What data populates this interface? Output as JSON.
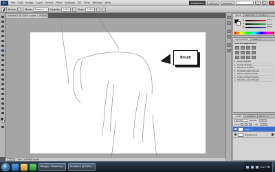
{
  "app": {
    "logo": "Ps"
  },
  "menubar": {
    "items": [
      "File",
      "Edit",
      "Image",
      "Layer",
      "Select",
      "Filter",
      "Analysis",
      "3D",
      "View",
      "Window",
      "Help"
    ],
    "workspaces": [
      "ESSENTIALS",
      "DESIGN",
      "PAINTING"
    ],
    "active_workspace": "ESSENTIALS"
  },
  "options": {
    "brush_label": "Brush:",
    "mode_label": "Mode:",
    "mode_value": "Normal",
    "opacity_label": "Opacity:",
    "opacity_value": "100%",
    "flow_label": "Flow:",
    "flow_value": "100%"
  },
  "document": {
    "tab_title": "Untitled-1 @ 100% (Layer 1, RGB/8) *",
    "zoom": "100%",
    "doc_info": "Doc: 1.03M/0 bytes"
  },
  "canvas": {
    "callout_text": "Brush"
  },
  "panels": {
    "color": {
      "tabs": [
        "COLOR",
        "SWATCHES",
        "STYLES"
      ],
      "sliders": [
        "R",
        "G",
        "B"
      ],
      "colors": {
        "foreground": "#000000",
        "background": "#ffffff",
        "r_track": "#d8262a",
        "g_track": "#2fae3a",
        "b_track": "#2c4fd4"
      }
    },
    "adjustments": {
      "tabs": [
        "ADJUSTMENTS",
        "MASKS"
      ],
      "title": "Add an adjustment",
      "presets": [
        "Levels Presets",
        "Curves Presets",
        "Exposure Presets",
        "Hue/Saturation Presets",
        "Black & White Presets",
        "Channel Mixer Presets",
        "Selective Color Presets"
      ]
    },
    "layers": {
      "tabs": [
        "LAYERS",
        "CHANNELS",
        "PATHS"
      ],
      "blend_mode": "Normal",
      "opacity_label": "Opacity:",
      "opacity_value": "100%",
      "lock_label": "Lock:",
      "fill_label": "Fill:",
      "fill_value": "100%",
      "rows": [
        {
          "name": "Layer 1",
          "selected": true
        },
        {
          "name": "Background",
          "selected": false
        }
      ]
    }
  },
  "taskbar": {
    "tasks": [
      "Blogger: Photoshop...",
      "Untitled-1 @ 100%..."
    ],
    "time": "5:21 PM"
  }
}
